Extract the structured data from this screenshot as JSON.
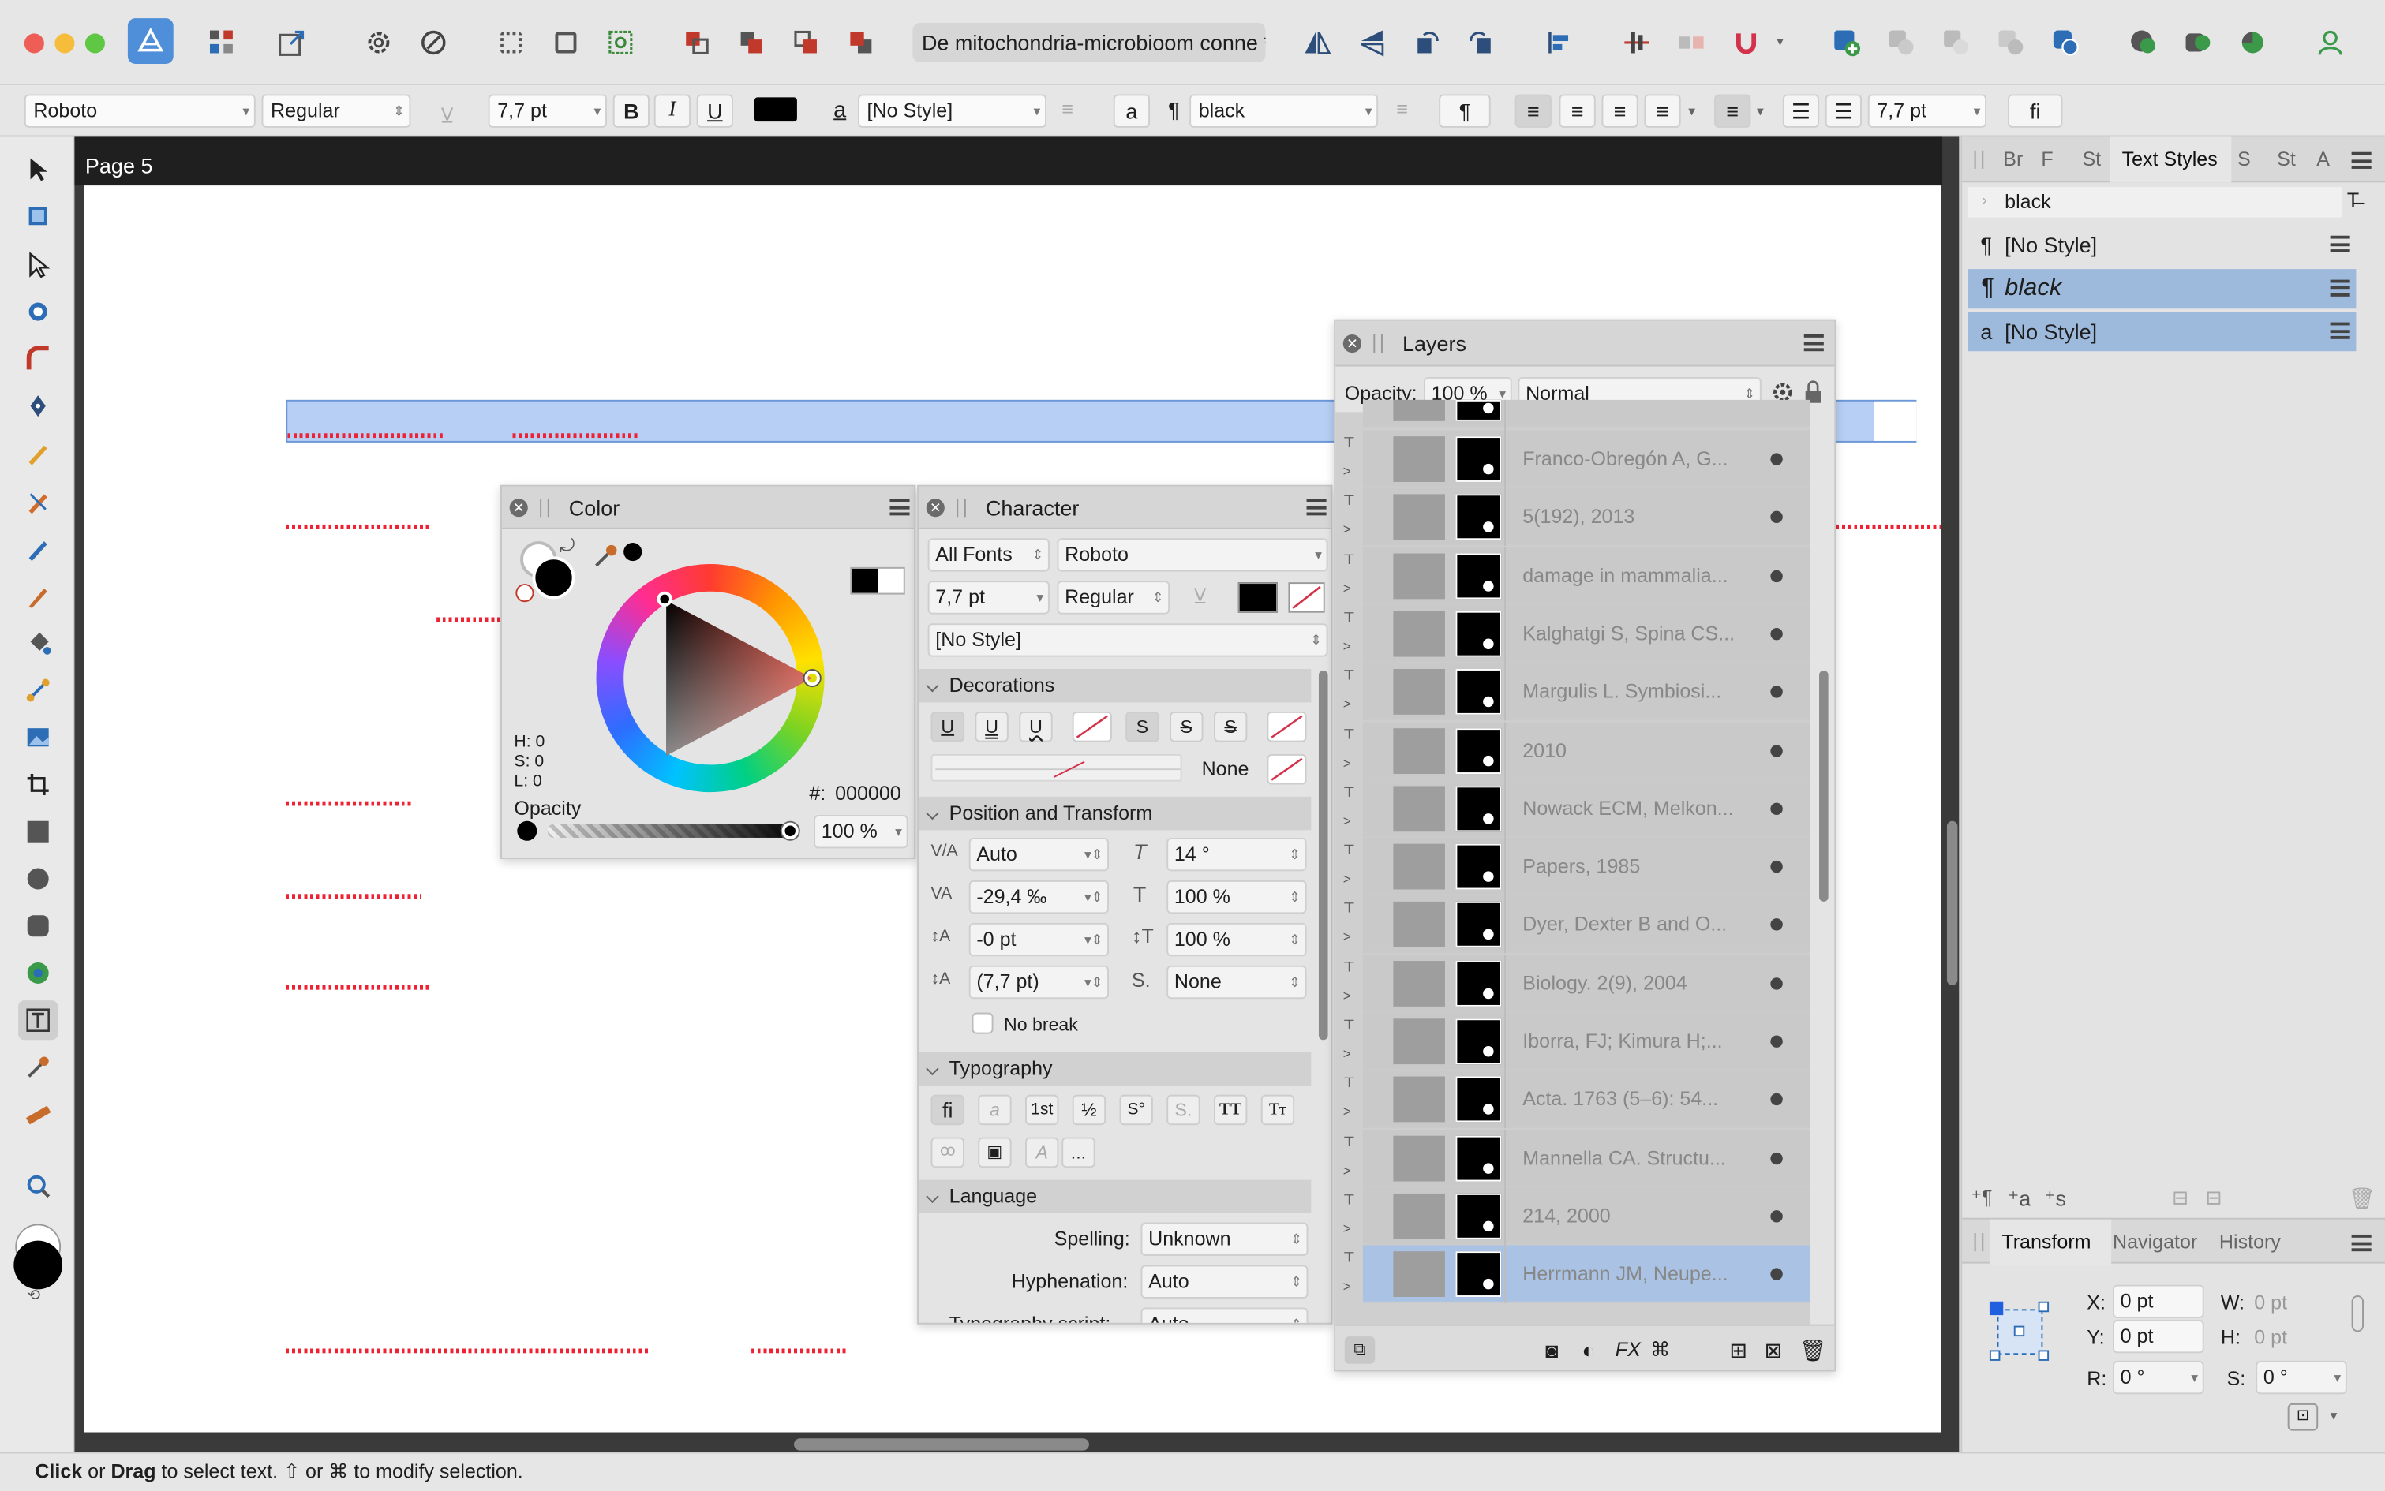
{
  "document": {
    "title": "De mitochondria-microbioom conne",
    "modified_mark": "*"
  },
  "context_toolbar": {
    "font_family": "Roboto",
    "font_style": "Regular",
    "font_size": "7,7 pt",
    "bold": "B",
    "italic": "I",
    "underline": "U",
    "char_style_icon": "a",
    "char_style": "[No Style]",
    "a_button": "a",
    "para_icon": "¶",
    "para_style": "black",
    "para_button": "¶",
    "spacing": "7,7 pt",
    "ligature": "ﬁ"
  },
  "canvas": {
    "page_label": "Page 5"
  },
  "color_panel": {
    "title": "Color",
    "h": "H: 0",
    "s": "S: 0",
    "l": "L: 0",
    "hex_label": "#:",
    "hex_value": "000000",
    "opacity_label": "Opacity",
    "opacity_value": "100 %",
    "current_color": "#000000",
    "hue_marker_color": "#d43a2b"
  },
  "character_panel": {
    "title": "Character",
    "font_collection": "All Fonts",
    "font_family": "Roboto",
    "font_size": "7,7 pt",
    "font_style": "Regular",
    "style": "[No Style]",
    "decorations_title": "Decorations",
    "decoration_buttons": [
      "U",
      "U",
      "U",
      "S",
      "S",
      "S"
    ],
    "line_none": "None",
    "position_title": "Position and Transform",
    "kerning": "Auto",
    "shear": "14 °",
    "tracking": "-29,4 ‰",
    "vscale": "100 %",
    "baseline": "-0 pt",
    "hscale": "100 %",
    "leading": "(7,7 pt)",
    "position": "None",
    "no_break": "No break",
    "typography_title": "Typography",
    "typo_buttons": [
      "ﬁ",
      "a",
      "1st",
      "½",
      "S°",
      "S.",
      "TT",
      "Tт"
    ],
    "more": "...",
    "language_title": "Language",
    "spelling_label": "Spelling:",
    "spelling_value": "Unknown",
    "hyphenation_label": "Hyphenation:",
    "hyphenation_value": "Auto",
    "typo_script_label": "Typography script:",
    "typo_script_value": "Auto"
  },
  "layers_panel": {
    "title": "Layers",
    "opacity_label": "Opacity:",
    "opacity_value": "100 %",
    "blend_mode": "Normal",
    "layers": [
      {
        "name": "Franco-Obregón A, G...",
        "selected": false
      },
      {
        "name": "5(192), 2013",
        "selected": false
      },
      {
        "name": "damage in mammalia...",
        "selected": false
      },
      {
        "name": "Kalghatgi S, Spina CS...",
        "selected": false
      },
      {
        "name": "Margulis L. Symbiosi...",
        "selected": false
      },
      {
        "name": "2010",
        "selected": false
      },
      {
        "name": "Nowack ECM, Melkon...",
        "selected": false
      },
      {
        "name": "Papers, 1985",
        "selected": false
      },
      {
        "name": "Dyer, Dexter B and O...",
        "selected": false
      },
      {
        "name": "Biology. 2(9), 2004",
        "selected": false
      },
      {
        "name": "Iborra, FJ; Kimura H;...",
        "selected": false
      },
      {
        "name": "Acta. 1763 (5–6): 54...",
        "selected": false
      },
      {
        "name": "Mannella CA. Structu...",
        "selected": false
      },
      {
        "name": "214, 2000",
        "selected": false
      },
      {
        "name": "Herrmann JM, Neupe...",
        "selected": true
      }
    ]
  },
  "text_styles_panel": {
    "tabs": [
      "Br",
      "F",
      "St",
      "Text Styles",
      "S",
      "St",
      "A"
    ],
    "active_tab": "Text Styles",
    "filter": "black",
    "styles": [
      {
        "icon": "¶",
        "name": "[No Style]",
        "selected": false
      },
      {
        "icon": "¶",
        "name": "black",
        "selected": true
      },
      {
        "icon": "a",
        "name": "[No Style]",
        "selected": true
      }
    ]
  },
  "transform_panel": {
    "tabs": [
      "Transform",
      "Navigator",
      "History"
    ],
    "x_label": "X:",
    "x_value": "0 pt",
    "y_label": "Y:",
    "y_value": "0 pt",
    "w_label": "W:",
    "w_value": "0 pt",
    "h_label": "H:",
    "h_value": "0 pt",
    "r_label": "R:",
    "r_value": "0 °",
    "s_label": "S:",
    "s_value": "0 °"
  },
  "status_bar": {
    "click": "Click",
    "or1": " or ",
    "drag": "Drag",
    "rest": " to select text. ⇧ or ⌘ to modify selection."
  }
}
